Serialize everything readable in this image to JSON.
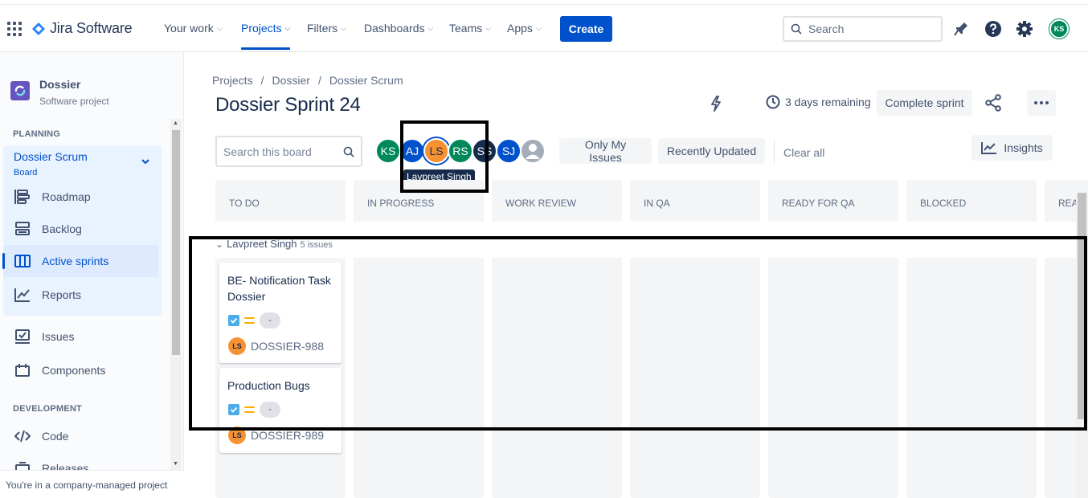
{
  "topnav": {
    "brand": "Jira Software",
    "items": [
      {
        "label": "Your work"
      },
      {
        "label": "Projects"
      },
      {
        "label": "Filters"
      },
      {
        "label": "Dashboards"
      },
      {
        "label": "Teams"
      },
      {
        "label": "Apps"
      }
    ],
    "create_label": "Create",
    "search_placeholder": "Search",
    "user_initials": "KS"
  },
  "sidebar": {
    "project_name": "Dossier",
    "project_type": "Software project",
    "planning_title": "PLANNING",
    "board_name": "Dossier Scrum",
    "board_sub": "Board",
    "planning_items": [
      {
        "label": "Roadmap"
      },
      {
        "label": "Backlog"
      },
      {
        "label": "Active sprints"
      },
      {
        "label": "Reports"
      }
    ],
    "other_items": [
      {
        "label": "Issues"
      },
      {
        "label": "Components"
      }
    ],
    "development_title": "DEVELOPMENT",
    "dev_items": [
      {
        "label": "Code"
      },
      {
        "label": "Releases"
      }
    ],
    "footer": "You're in a company-managed project"
  },
  "main": {
    "breadcrumb": [
      "Projects",
      "Dossier",
      "Dossier Scrum"
    ],
    "breadcrumb_sep": "/",
    "title": "Dossier Sprint 24",
    "remaining": "3 days remaining",
    "complete_label": "Complete sprint",
    "search_placeholder": "Search this board",
    "avatars": [
      {
        "initials": "KS",
        "color": "#00875a"
      },
      {
        "initials": "AJ",
        "color": "#0052cc"
      },
      {
        "initials": "LS",
        "color": "#f79232"
      },
      {
        "initials": "RS",
        "color": "#00875a"
      },
      {
        "initials": "SS",
        "color": "#172b4d"
      },
      {
        "initials": "SJ",
        "color": "#0052cc"
      }
    ],
    "tooltip": "Lavpreet Singh",
    "only_my_issues": "Only My Issues",
    "recently_updated": "Recently Updated",
    "clear_all": "Clear all",
    "insights": "Insights",
    "columns": [
      "TO DO",
      "IN PROGRESS",
      "WORK REVIEW",
      "IN QA",
      "READY FOR QA",
      "BLOCKED",
      "REA"
    ],
    "swimlane": {
      "name": "Lavpreet Singh",
      "count": "5 issues"
    },
    "cards": [
      {
        "title": "BE- Notification Task Dossier",
        "estimate": "-",
        "key": "DOSSIER-988",
        "assignee": "LS"
      },
      {
        "title": "Production Bugs",
        "estimate": "-",
        "key": "DOSSIER-989",
        "assignee": "LS"
      }
    ]
  },
  "colors": {
    "brand_blue": "#0052cc",
    "highlight": "#000000",
    "column_bg": "#f4f5f7"
  }
}
